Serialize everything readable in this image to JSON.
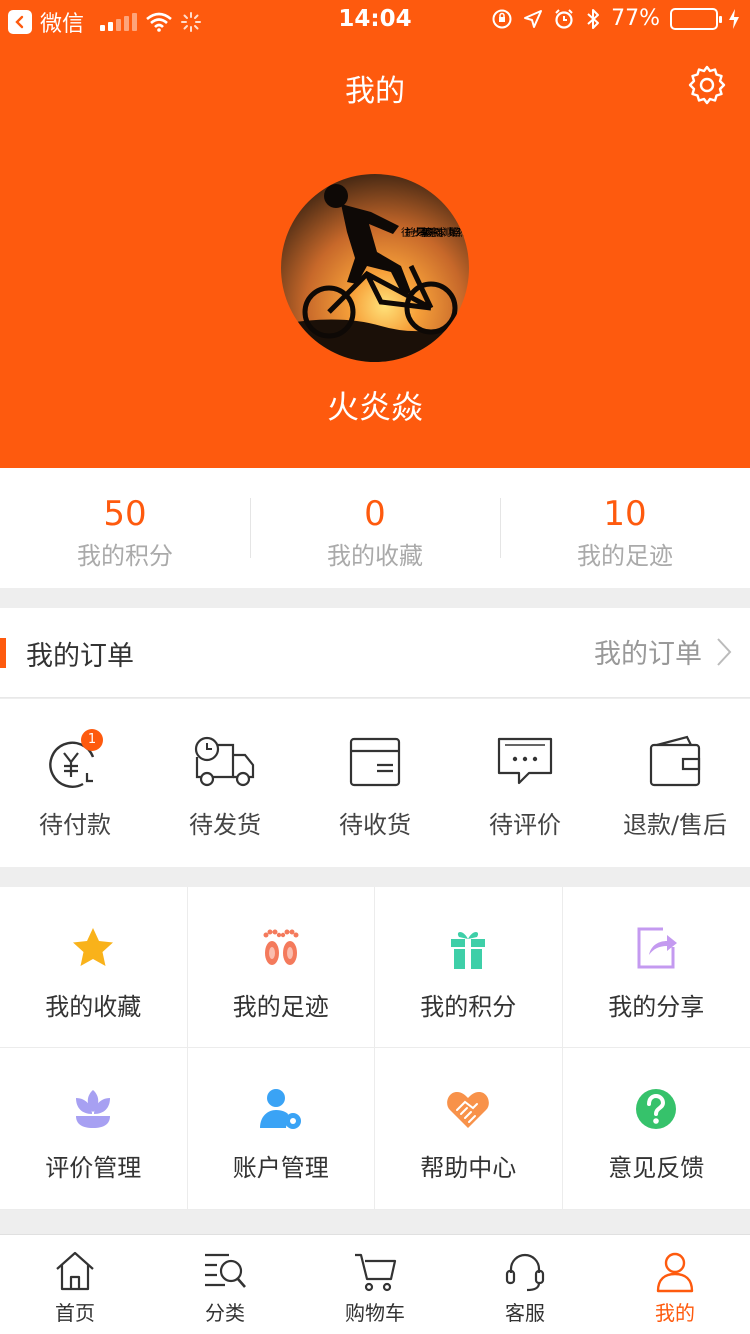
{
  "status_bar": {
    "app": "微信",
    "time": "14:04",
    "battery": "77%",
    "battery_level": 0.77
  },
  "header": {
    "title": "我的",
    "username": "火炎焱",
    "avatar_caption": "往前一步是幸福 / 不用刻意强求，顺其自然"
  },
  "stats": [
    {
      "value": "50",
      "label": "我的积分"
    },
    {
      "value": "0",
      "label": "我的收藏"
    },
    {
      "value": "10",
      "label": "我的足迹"
    }
  ],
  "orders": {
    "title": "我的订单",
    "link": "我的订单",
    "badge": "1",
    "items": [
      {
        "label": "待付款",
        "icon": "pending-payment-icon"
      },
      {
        "label": "待发货",
        "icon": "pending-shipment-icon"
      },
      {
        "label": "待收货",
        "icon": "pending-receipt-icon"
      },
      {
        "label": "待评价",
        "icon": "pending-review-icon"
      },
      {
        "label": "退款/售后",
        "icon": "refund-wallet-icon"
      }
    ]
  },
  "grid": [
    {
      "label": "我的收藏",
      "icon": "star-icon",
      "color": "#f9b21a"
    },
    {
      "label": "我的足迹",
      "icon": "footprint-icon",
      "color": "#f47a5c"
    },
    {
      "label": "我的积分",
      "icon": "gift-icon",
      "color": "#3ecfa8"
    },
    {
      "label": "我的分享",
      "icon": "share-icon",
      "color": "#c49af0"
    },
    {
      "label": "评价管理",
      "icon": "flower-icon",
      "color": "#a7a0f2"
    },
    {
      "label": "账户管理",
      "icon": "user-settings-icon",
      "color": "#3aa3f5"
    },
    {
      "label": "帮助中心",
      "icon": "handshake-heart-icon",
      "color": "#f8924a"
    },
    {
      "label": "意见反馈",
      "icon": "question-icon",
      "color": "#36c26b"
    }
  ],
  "tabbar": [
    {
      "label": "首页",
      "icon": "home-icon"
    },
    {
      "label": "分类",
      "icon": "category-search-icon"
    },
    {
      "label": "购物车",
      "icon": "cart-icon"
    },
    {
      "label": "客服",
      "icon": "headset-icon"
    },
    {
      "label": "我的",
      "icon": "profile-icon",
      "active": true
    }
  ],
  "colors": {
    "accent": "#fe5a0e",
    "background": "#eeeeee"
  }
}
